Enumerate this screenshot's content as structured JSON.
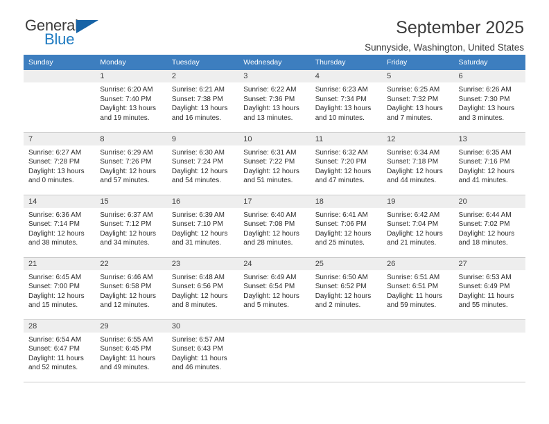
{
  "brand": {
    "name_part1": "General",
    "name_part2": "Blue",
    "accent_color": "#1f7bc1",
    "flag_icon": "triangle-flag-icon"
  },
  "header": {
    "title": "September 2025",
    "subtitle": "Sunnyside, Washington, United States",
    "header_bg_color": "#3d7ebf",
    "daynum_bg_color": "#eeeeee"
  },
  "weekday_headers": [
    "Sunday",
    "Monday",
    "Tuesday",
    "Wednesday",
    "Thursday",
    "Friday",
    "Saturday"
  ],
  "labels": {
    "sunrise": "Sunrise:",
    "sunset": "Sunset:",
    "daylight": "Daylight:"
  },
  "weeks": [
    [
      {
        "day": "",
        "sunrise": "",
        "sunset": "",
        "daylight": "",
        "empty": true
      },
      {
        "day": "1",
        "sunrise": "Sunrise: 6:20 AM",
        "sunset": "Sunset: 7:40 PM",
        "daylight": "Daylight: 13 hours and 19 minutes."
      },
      {
        "day": "2",
        "sunrise": "Sunrise: 6:21 AM",
        "sunset": "Sunset: 7:38 PM",
        "daylight": "Daylight: 13 hours and 16 minutes."
      },
      {
        "day": "3",
        "sunrise": "Sunrise: 6:22 AM",
        "sunset": "Sunset: 7:36 PM",
        "daylight": "Daylight: 13 hours and 13 minutes."
      },
      {
        "day": "4",
        "sunrise": "Sunrise: 6:23 AM",
        "sunset": "Sunset: 7:34 PM",
        "daylight": "Daylight: 13 hours and 10 minutes."
      },
      {
        "day": "5",
        "sunrise": "Sunrise: 6:25 AM",
        "sunset": "Sunset: 7:32 PM",
        "daylight": "Daylight: 13 hours and 7 minutes."
      },
      {
        "day": "6",
        "sunrise": "Sunrise: 6:26 AM",
        "sunset": "Sunset: 7:30 PM",
        "daylight": "Daylight: 13 hours and 3 minutes."
      }
    ],
    [
      {
        "day": "7",
        "sunrise": "Sunrise: 6:27 AM",
        "sunset": "Sunset: 7:28 PM",
        "daylight": "Daylight: 13 hours and 0 minutes."
      },
      {
        "day": "8",
        "sunrise": "Sunrise: 6:29 AM",
        "sunset": "Sunset: 7:26 PM",
        "daylight": "Daylight: 12 hours and 57 minutes."
      },
      {
        "day": "9",
        "sunrise": "Sunrise: 6:30 AM",
        "sunset": "Sunset: 7:24 PM",
        "daylight": "Daylight: 12 hours and 54 minutes."
      },
      {
        "day": "10",
        "sunrise": "Sunrise: 6:31 AM",
        "sunset": "Sunset: 7:22 PM",
        "daylight": "Daylight: 12 hours and 51 minutes."
      },
      {
        "day": "11",
        "sunrise": "Sunrise: 6:32 AM",
        "sunset": "Sunset: 7:20 PM",
        "daylight": "Daylight: 12 hours and 47 minutes."
      },
      {
        "day": "12",
        "sunrise": "Sunrise: 6:34 AM",
        "sunset": "Sunset: 7:18 PM",
        "daylight": "Daylight: 12 hours and 44 minutes."
      },
      {
        "day": "13",
        "sunrise": "Sunrise: 6:35 AM",
        "sunset": "Sunset: 7:16 PM",
        "daylight": "Daylight: 12 hours and 41 minutes."
      }
    ],
    [
      {
        "day": "14",
        "sunrise": "Sunrise: 6:36 AM",
        "sunset": "Sunset: 7:14 PM",
        "daylight": "Daylight: 12 hours and 38 minutes."
      },
      {
        "day": "15",
        "sunrise": "Sunrise: 6:37 AM",
        "sunset": "Sunset: 7:12 PM",
        "daylight": "Daylight: 12 hours and 34 minutes."
      },
      {
        "day": "16",
        "sunrise": "Sunrise: 6:39 AM",
        "sunset": "Sunset: 7:10 PM",
        "daylight": "Daylight: 12 hours and 31 minutes."
      },
      {
        "day": "17",
        "sunrise": "Sunrise: 6:40 AM",
        "sunset": "Sunset: 7:08 PM",
        "daylight": "Daylight: 12 hours and 28 minutes."
      },
      {
        "day": "18",
        "sunrise": "Sunrise: 6:41 AM",
        "sunset": "Sunset: 7:06 PM",
        "daylight": "Daylight: 12 hours and 25 minutes."
      },
      {
        "day": "19",
        "sunrise": "Sunrise: 6:42 AM",
        "sunset": "Sunset: 7:04 PM",
        "daylight": "Daylight: 12 hours and 21 minutes."
      },
      {
        "day": "20",
        "sunrise": "Sunrise: 6:44 AM",
        "sunset": "Sunset: 7:02 PM",
        "daylight": "Daylight: 12 hours and 18 minutes."
      }
    ],
    [
      {
        "day": "21",
        "sunrise": "Sunrise: 6:45 AM",
        "sunset": "Sunset: 7:00 PM",
        "daylight": "Daylight: 12 hours and 15 minutes."
      },
      {
        "day": "22",
        "sunrise": "Sunrise: 6:46 AM",
        "sunset": "Sunset: 6:58 PM",
        "daylight": "Daylight: 12 hours and 12 minutes."
      },
      {
        "day": "23",
        "sunrise": "Sunrise: 6:48 AM",
        "sunset": "Sunset: 6:56 PM",
        "daylight": "Daylight: 12 hours and 8 minutes."
      },
      {
        "day": "24",
        "sunrise": "Sunrise: 6:49 AM",
        "sunset": "Sunset: 6:54 PM",
        "daylight": "Daylight: 12 hours and 5 minutes."
      },
      {
        "day": "25",
        "sunrise": "Sunrise: 6:50 AM",
        "sunset": "Sunset: 6:52 PM",
        "daylight": "Daylight: 12 hours and 2 minutes."
      },
      {
        "day": "26",
        "sunrise": "Sunrise: 6:51 AM",
        "sunset": "Sunset: 6:51 PM",
        "daylight": "Daylight: 11 hours and 59 minutes."
      },
      {
        "day": "27",
        "sunrise": "Sunrise: 6:53 AM",
        "sunset": "Sunset: 6:49 PM",
        "daylight": "Daylight: 11 hours and 55 minutes."
      }
    ],
    [
      {
        "day": "28",
        "sunrise": "Sunrise: 6:54 AM",
        "sunset": "Sunset: 6:47 PM",
        "daylight": "Daylight: 11 hours and 52 minutes."
      },
      {
        "day": "29",
        "sunrise": "Sunrise: 6:55 AM",
        "sunset": "Sunset: 6:45 PM",
        "daylight": "Daylight: 11 hours and 49 minutes."
      },
      {
        "day": "30",
        "sunrise": "Sunrise: 6:57 AM",
        "sunset": "Sunset: 6:43 PM",
        "daylight": "Daylight: 11 hours and 46 minutes."
      },
      {
        "day": "",
        "sunrise": "",
        "sunset": "",
        "daylight": "",
        "empty": true
      },
      {
        "day": "",
        "sunrise": "",
        "sunset": "",
        "daylight": "",
        "empty": true
      },
      {
        "day": "",
        "sunrise": "",
        "sunset": "",
        "daylight": "",
        "empty": true
      },
      {
        "day": "",
        "sunrise": "",
        "sunset": "",
        "daylight": "",
        "empty": true
      }
    ]
  ]
}
